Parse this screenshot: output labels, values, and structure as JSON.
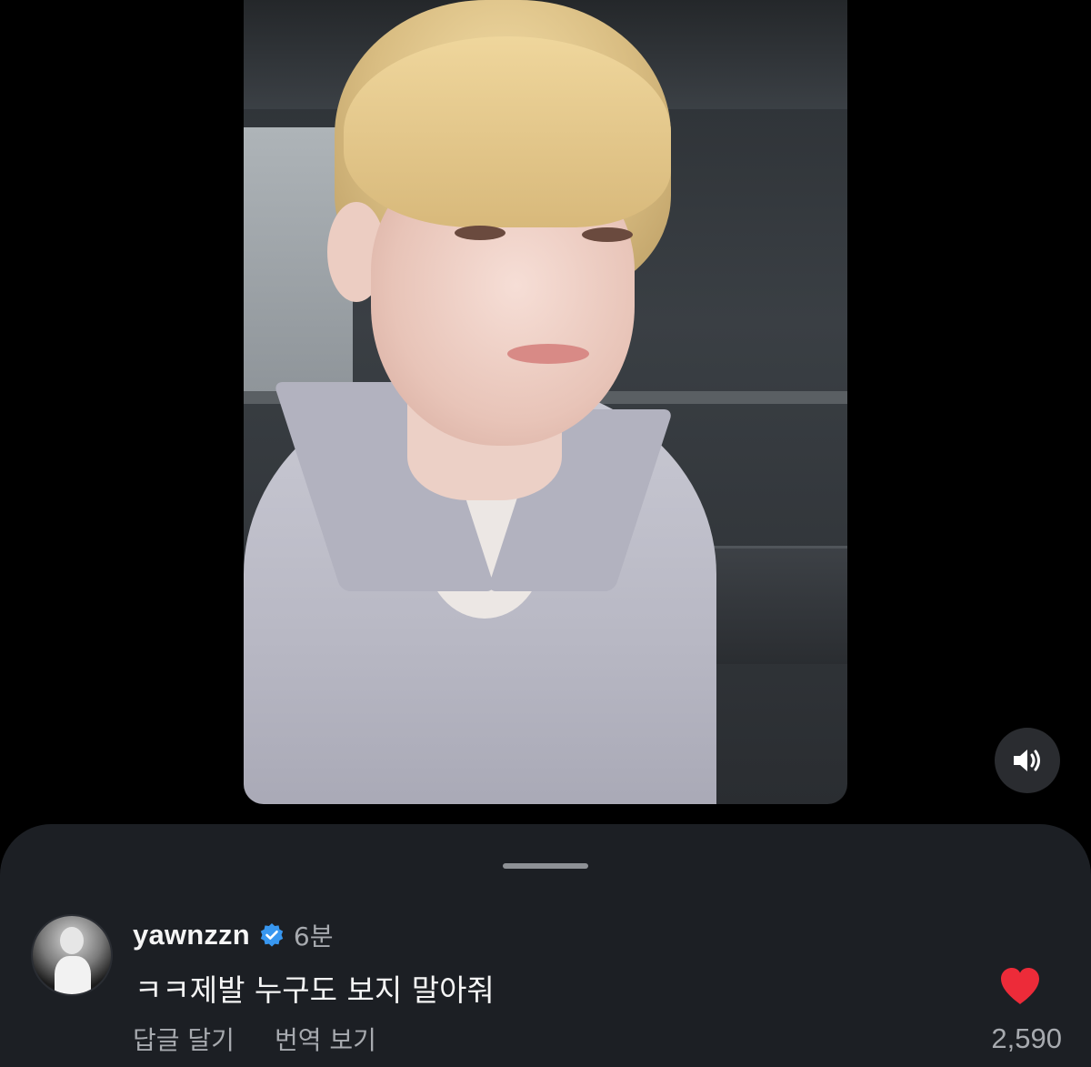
{
  "comment": {
    "username": "yawnzzn",
    "verified": true,
    "timestamp": "6분",
    "text": "ㅋㅋ제발 누구도 보지 말아줘",
    "reply_label": "답글 달기",
    "translate_label": "번역 보기",
    "like_count": "2,590",
    "liked": true
  },
  "icons": {
    "sound": "speaker-volume-icon",
    "verified": "verified-badge-icon",
    "like": "heart-filled-icon"
  },
  "colors": {
    "background": "#000000",
    "sheet": "#1c1f24",
    "verified_blue": "#3897f0",
    "like_red": "#ed2b39",
    "muted_text": "#a7aaaf"
  }
}
